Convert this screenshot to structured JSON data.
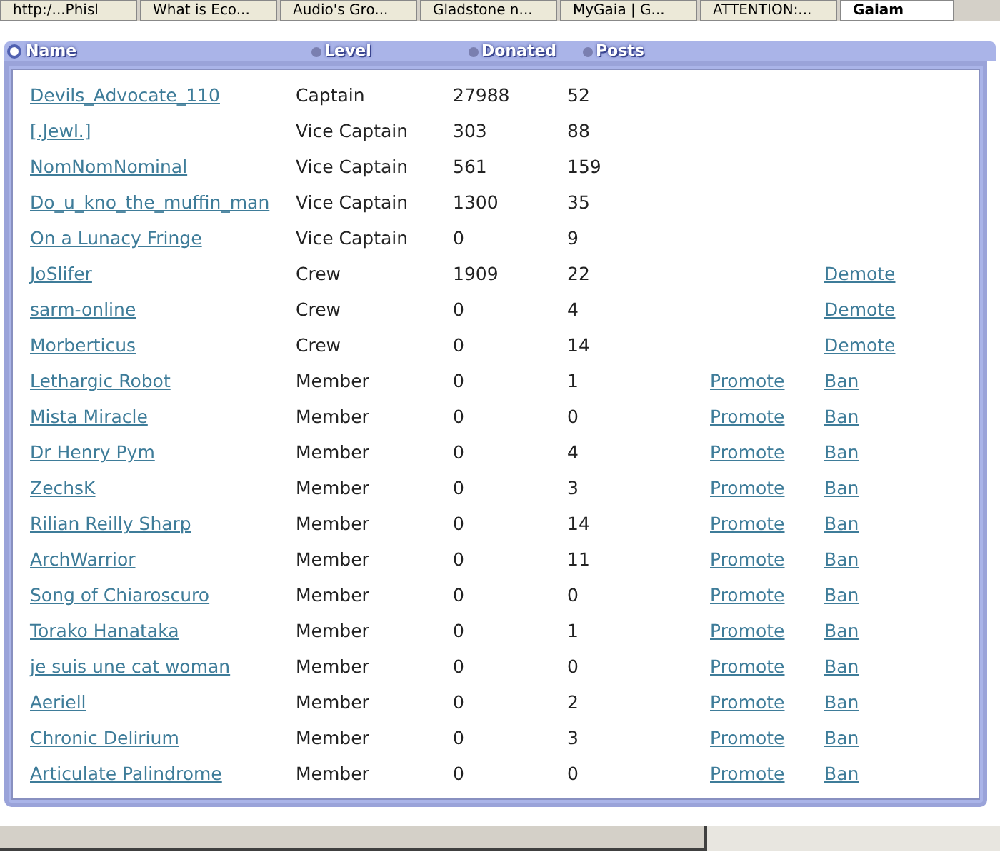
{
  "browser_tabs": [
    {
      "label": "http:/...Phisl",
      "selected": false
    },
    {
      "label": "What is Eco...",
      "selected": false
    },
    {
      "label": "Audio's Gro...",
      "selected": false
    },
    {
      "label": "Gladstone n...",
      "selected": false
    },
    {
      "label": "MyGaia | G...",
      "selected": false
    },
    {
      "label": "ATTENTION:...",
      "selected": false
    },
    {
      "label": "Gaiam",
      "selected": true
    }
  ],
  "table": {
    "columns": [
      "Name",
      "Level",
      "Donated",
      "Posts"
    ],
    "rows": [
      {
        "name": "Devils_Advocate_110",
        "level": "Captain",
        "donated": "27988",
        "posts": "52"
      },
      {
        "name": "[.Jewl.]",
        "level": "Vice Captain",
        "donated": "303",
        "posts": "88"
      },
      {
        "name": "NomNomNominal",
        "level": "Vice Captain",
        "donated": "561",
        "posts": "159"
      },
      {
        "name": "Do_u_kno_the_muffin_man",
        "level": "Vice Captain",
        "donated": "1300",
        "posts": "35"
      },
      {
        "name": "On a Lunacy Fringe",
        "level": "Vice Captain",
        "donated": "0",
        "posts": "9"
      },
      {
        "name": "JoSlifer",
        "level": "Crew",
        "donated": "1909",
        "posts": "22",
        "column_6": "Demote"
      },
      {
        "name": "sarm-online",
        "level": "Crew",
        "donated": "0",
        "posts": "4",
        "column_6": "Demote"
      },
      {
        "name": "Morberticus",
        "level": "Crew",
        "donated": "0",
        "posts": "14",
        "column_6": "Demote"
      },
      {
        "name": "Lethargic Robot",
        "level": "Member",
        "donated": "0",
        "posts": "1",
        "column_5": "Promote",
        "column_6": "Ban"
      },
      {
        "name": "Mista Miracle",
        "level": "Member",
        "donated": "0",
        "posts": "0",
        "column_5": "Promote",
        "column_6": "Ban"
      },
      {
        "name": "Dr Henry Pym",
        "level": "Member",
        "donated": "0",
        "posts": "4",
        "column_5": "Promote",
        "column_6": "Ban"
      },
      {
        "name": "ZechsK",
        "level": "Member",
        "donated": "0",
        "posts": "3",
        "column_5": "Promote",
        "column_6": "Ban"
      },
      {
        "name": "Rilian Reilly Sharp",
        "level": "Member",
        "donated": "0",
        "posts": "14",
        "column_5": "Promote",
        "column_6": "Ban"
      },
      {
        "name": "ArchWarrior",
        "level": "Member",
        "donated": "0",
        "posts": "11",
        "column_5": "Promote",
        "column_6": "Ban"
      },
      {
        "name": "Song of Chiaroscuro",
        "level": "Member",
        "donated": "0",
        "posts": "0",
        "column_5": "Promote",
        "column_6": "Ban"
      },
      {
        "name": "Torako Hanataka",
        "level": "Member",
        "donated": "0",
        "posts": "1",
        "column_5": "Promote",
        "column_6": "Ban"
      },
      {
        "name": "je suis une cat woman",
        "level": "Member",
        "donated": "0",
        "posts": "0",
        "column_5": "Promote",
        "column_6": "Ban"
      },
      {
        "name": "Aeriell",
        "level": "Member",
        "donated": "0",
        "posts": "2",
        "column_5": "Promote",
        "column_6": "Ban"
      },
      {
        "name": "Chronic Delirium",
        "level": "Member",
        "donated": "0",
        "posts": "3",
        "column_5": "Promote",
        "column_6": "Ban"
      },
      {
        "name": "Articulate Palindrome",
        "level": "Member",
        "donated": "0",
        "posts": "0",
        "column_5": "Promote",
        "column_6": "Ban"
      }
    ]
  }
}
